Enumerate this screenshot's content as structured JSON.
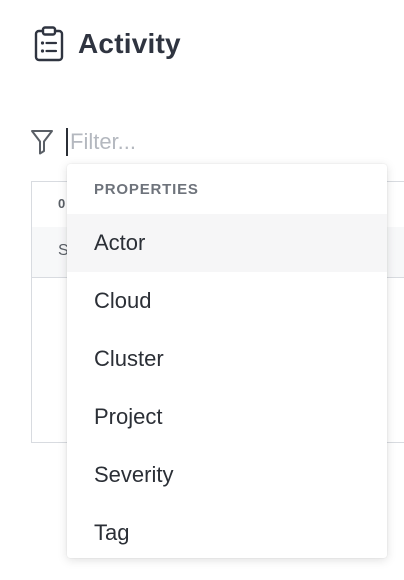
{
  "header": {
    "title": "Activity",
    "icon": "clipboard-list-icon"
  },
  "filter": {
    "icon": "filter-funnel-icon",
    "placeholder": "Filter...",
    "value": ""
  },
  "background_table": {
    "header_cell": "0",
    "row_cell": "S"
  },
  "dropdown": {
    "section_label": "PROPERTIES",
    "items": [
      {
        "label": "Actor",
        "highlighted": true
      },
      {
        "label": "Cloud"
      },
      {
        "label": "Cluster"
      },
      {
        "label": "Project"
      },
      {
        "label": "Severity"
      },
      {
        "label": "Tag"
      }
    ]
  },
  "colors": {
    "highlight": "#f6f6f7",
    "text": "#2b2f36",
    "muted": "#6e737b",
    "placeholder": "#b4b8bf",
    "border": "#d8dbe0"
  }
}
